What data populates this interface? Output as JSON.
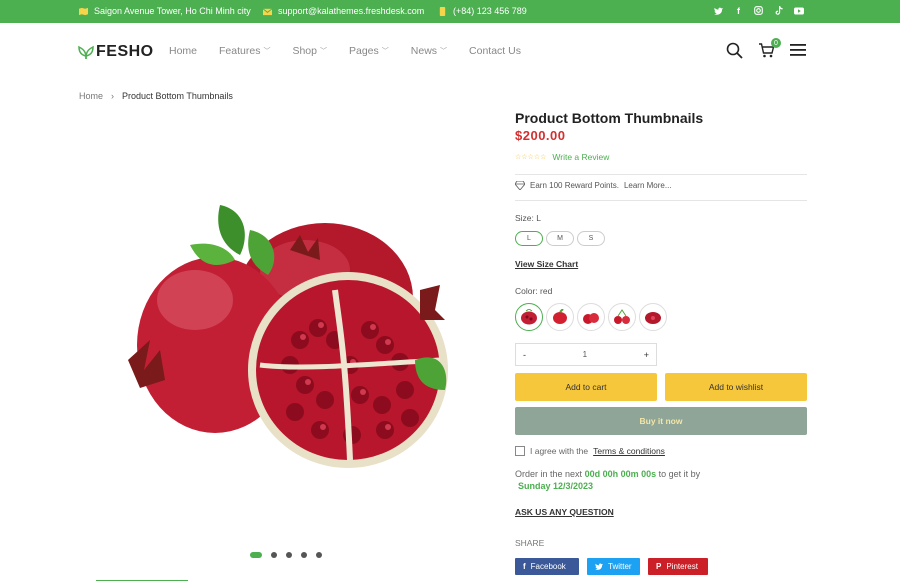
{
  "topbar": {
    "address": "Saigon Avenue Tower, Ho Chi Minh city",
    "email": "support@kalathemes.freshdesk.com",
    "phone": "(+84) 123 456 789",
    "social": [
      "twitter-icon",
      "facebook-icon",
      "instagram-icon",
      "tiktok-icon",
      "youtube-icon"
    ],
    "bg_color": "#4caf50"
  },
  "header": {
    "logo": "FESHO",
    "nav": [
      {
        "label": "Home",
        "dropdown": false
      },
      {
        "label": "Features",
        "dropdown": true
      },
      {
        "label": "Shop",
        "dropdown": true
      },
      {
        "label": "Pages",
        "dropdown": true
      },
      {
        "label": "News",
        "dropdown": true
      },
      {
        "label": "Contact Us",
        "dropdown": false
      }
    ],
    "cart_count": "0"
  },
  "breadcrumb": {
    "home": "Home",
    "current": "Product Bottom Thumbnails"
  },
  "gallery": {
    "dots": 5,
    "active_dot": 0
  },
  "product": {
    "title": "Product Bottom Thumbnails",
    "price": "$200.00",
    "rating_stars": "☆☆☆☆☆",
    "write_review": "Write a Review",
    "reward": "Earn 100 Reward Points.",
    "learn_more": "Learn More...",
    "size_label": "Size: L",
    "sizes": [
      "L",
      "M",
      "S"
    ],
    "selected_size": "L",
    "size_chart": "View Size Chart",
    "color_label": "Color: red",
    "colors": 5,
    "quantity": "1",
    "minus": "-",
    "plus": "+",
    "add_to_cart": "Add to cart",
    "add_to_wishlist": "Add to wishlist",
    "buy_now": "Buy it now",
    "agree_text": "I agree with the",
    "terms": "Terms & conditions",
    "order_prefix": "Order in the next",
    "countdown": "00d 00h 00m 00s",
    "order_suffix": "to get it by",
    "delivery_date": "Sunday 12/3/2023",
    "ask": "ASK US ANY QUESTION",
    "share_label": "SHARE",
    "share": {
      "facebook": "Facebook",
      "twitter": "Twitter",
      "pinterest": "Pinterest"
    },
    "accent_color": "#4caf50",
    "price_color": "#d32f2f",
    "button_color": "#f7c73b"
  }
}
